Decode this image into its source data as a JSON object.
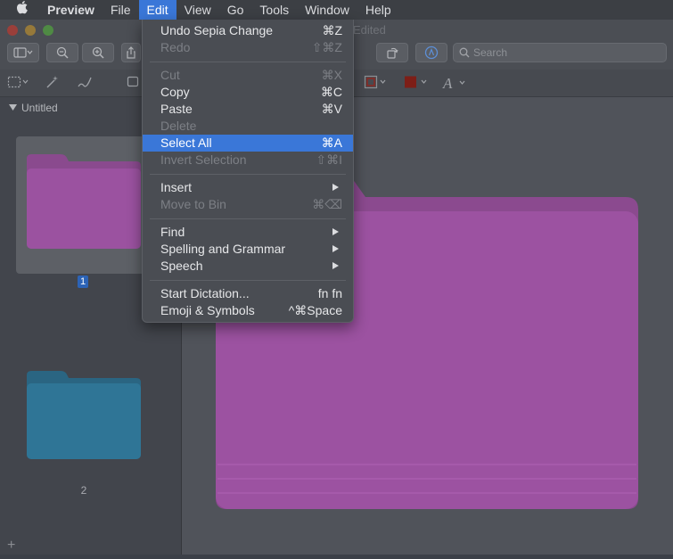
{
  "menubar": {
    "apple": "",
    "items": [
      "Preview",
      "File",
      "Edit",
      "View",
      "Go",
      "Tools",
      "Window",
      "Help"
    ]
  },
  "window": {
    "edited_label": "Edited"
  },
  "toolbar": {
    "search_placeholder": "Search"
  },
  "sidebar": {
    "header": "Untitled",
    "page1": "1",
    "page2": "2",
    "add": "+"
  },
  "edit_menu": {
    "undo": {
      "label": "Undo Sepia Change",
      "shortcut": "⌘Z"
    },
    "redo": {
      "label": "Redo",
      "shortcut": "⇧⌘Z"
    },
    "cut": {
      "label": "Cut",
      "shortcut": "⌘X"
    },
    "copy": {
      "label": "Copy",
      "shortcut": "⌘C"
    },
    "paste": {
      "label": "Paste",
      "shortcut": "⌘V"
    },
    "delete": {
      "label": "Delete",
      "shortcut": ""
    },
    "select_all": {
      "label": "Select All",
      "shortcut": "⌘A"
    },
    "invert_selection": {
      "label": "Invert Selection",
      "shortcut": "⇧⌘I"
    },
    "insert": {
      "label": "Insert"
    },
    "move_to_bin": {
      "label": "Move to Bin",
      "shortcut": "⌘⌫"
    },
    "find": {
      "label": "Find"
    },
    "spelling": {
      "label": "Spelling and Grammar"
    },
    "speech": {
      "label": "Speech"
    },
    "dictation": {
      "label": "Start Dictation...",
      "shortcut": "fn fn"
    },
    "emoji": {
      "label": "Emoji & Symbols",
      "shortcut": "^⌘Space"
    }
  },
  "colors": {
    "menu_highlight": "#3a77d8",
    "folder_purple": "#9b4e9c",
    "folder_blue": "#2f6f8f"
  },
  "icons": [
    "apple-logo-icon",
    "sidebar-toggle-icon",
    "zoom-out-icon",
    "zoom-in-icon",
    "share-icon",
    "rotate-icon",
    "markup-pen-icon",
    "search-icon",
    "rect-selection-icon",
    "instant-alpha-icon",
    "sketch-icon",
    "shape-style-icon",
    "fill-color-icon",
    "text-style-icon",
    "submenu-arrow-icon"
  ]
}
